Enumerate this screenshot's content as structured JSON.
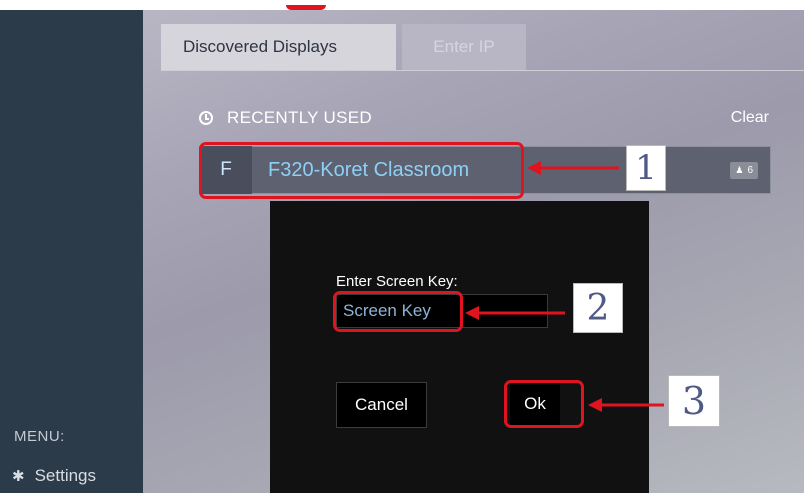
{
  "sidebar": {
    "menu_label": "MENU:",
    "settings_label": "Settings",
    "settings_icon": "gear-icon"
  },
  "tabs": [
    {
      "label": "Discovered Displays",
      "active": true
    },
    {
      "label": "Enter IP",
      "active": false
    }
  ],
  "recent": {
    "title": "RECENTLY USED",
    "clear_label": "Clear",
    "icon": "clock-icon"
  },
  "display": {
    "initial": "F",
    "name": "F320-Koret Classroom",
    "user_count": "6",
    "user_icon": "person-icon"
  },
  "dialog": {
    "prompt": "Enter Screen Key:",
    "placeholder": "Screen Key",
    "cancel_label": "Cancel",
    "ok_label": "Ok"
  },
  "annotations": {
    "step1": "1",
    "step2": "2",
    "step3": "3",
    "highlight_color": "#e0141e"
  }
}
